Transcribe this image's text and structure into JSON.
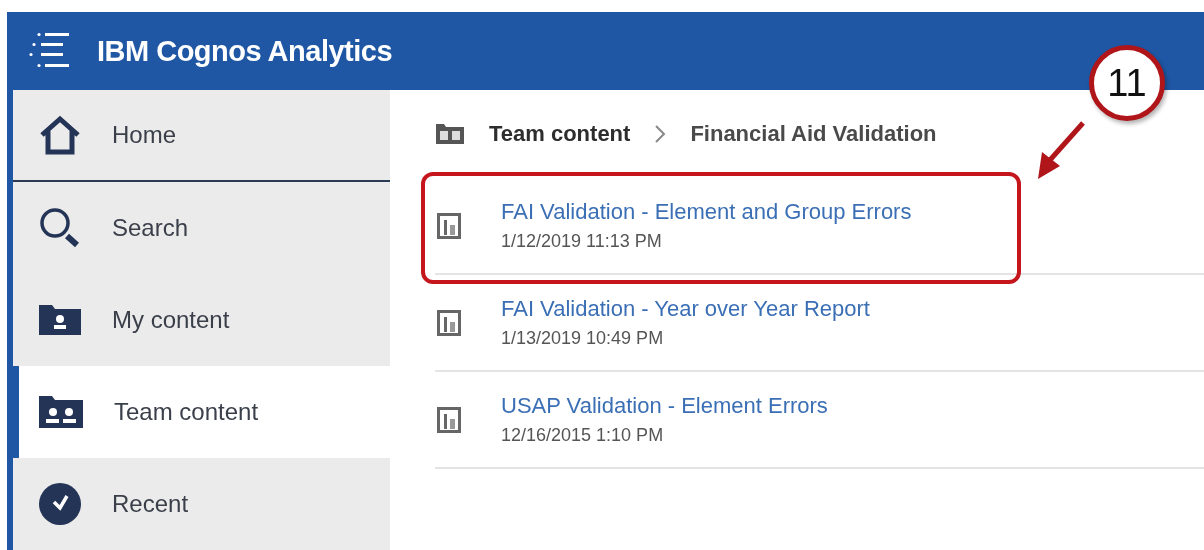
{
  "header": {
    "title": "IBM Cognos Analytics"
  },
  "sidebar": {
    "items": [
      {
        "label": "Home",
        "kind": "home",
        "selected": false
      },
      {
        "label": "Search",
        "kind": "search",
        "selected": false
      },
      {
        "label": "My content",
        "kind": "my-content",
        "selected": false
      },
      {
        "label": "Team content",
        "kind": "team-content",
        "selected": true
      },
      {
        "label": "Recent",
        "kind": "recent",
        "selected": false
      }
    ]
  },
  "breadcrumb": [
    "Team content",
    "Financial Aid Validation"
  ],
  "reports": [
    {
      "title": "FAI Validation - Element and Group Errors",
      "date": "1/12/2019 11:13 PM",
      "highlighted": true
    },
    {
      "title": "FAI Validation - Year over Year Report",
      "date": "1/13/2019 10:49 PM",
      "highlighted": false
    },
    {
      "title": "USAP Validation - Element Errors",
      "date": "12/16/2015 1:10 PM",
      "highlighted": false
    }
  ],
  "callout": {
    "label": "11"
  }
}
